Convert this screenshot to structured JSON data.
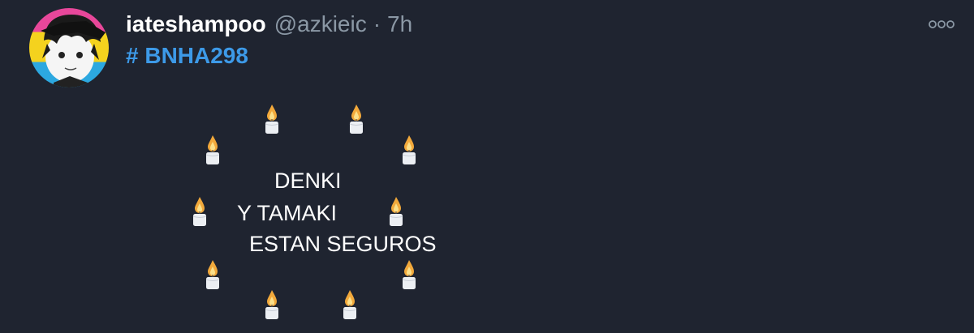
{
  "tweet": {
    "display_name": "iateshampoo",
    "handle": "@azkieic",
    "separator": "·",
    "time": "7h",
    "hashtag": "# BNHA298",
    "lines": [
      "DENKI",
      "Y TAMAKI",
      "ESTAN SEGUROS"
    ],
    "candle_icon": "candle-icon",
    "more_icon": "more-options-icon"
  },
  "colors": {
    "background": "#1f2430",
    "hashtag": "#3d9ae8",
    "muted": "#8b98a5",
    "text": "#ffffff",
    "flame": "#f2a93b",
    "candle_body": "#eceff3"
  }
}
